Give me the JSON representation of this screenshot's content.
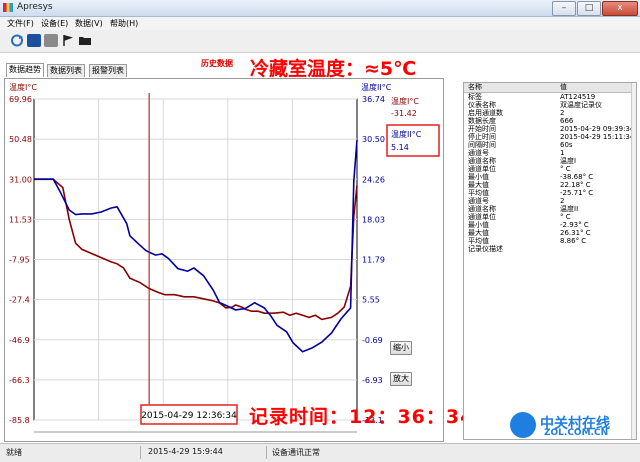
{
  "window": {
    "title": "Apresys",
    "controls": {
      "minimize": "–",
      "maximize": "□",
      "close": "x"
    }
  },
  "menu": [
    "文件(F)",
    "设备(E)",
    "数据(V)",
    "帮助(H)"
  ],
  "toolbar": {
    "icons": [
      "refresh-icon",
      "save-icon",
      "print-icon",
      "flag-icon",
      "folder-icon"
    ]
  },
  "tabs": [
    {
      "label": "数据趋势",
      "active": true
    },
    {
      "label": "数据列表",
      "active": false
    },
    {
      "label": "报警列表",
      "active": false
    }
  ],
  "history_label": "历史数据",
  "annotations": {
    "fridge_temp": "冷藏室温度：≈5℃",
    "record_time_label": "记录时间：12：36：34"
  },
  "chart_data": {
    "type": "line",
    "left_axis": {
      "title": "温度I°C",
      "ticks": [
        "69.96",
        "50.48",
        "31.00",
        "11.53",
        "-7.95",
        "-27.4",
        "-46.9",
        "-66.3",
        "-85.8"
      ],
      "range": [
        -85.8,
        69.96
      ]
    },
    "right_axis": {
      "title": "温度II°C",
      "ticks": [
        "36.74",
        "30.50",
        "24.26",
        "18.03",
        "11.79",
        "5.55",
        "-0.69",
        "-6.93",
        "-13.1"
      ],
      "range": [
        -13.1,
        36.74
      ]
    },
    "legend": [
      {
        "name": "温度I°C",
        "value": "-31.42",
        "color": "#8b0000"
      },
      {
        "name": "温度II°C",
        "value": "5.14",
        "color": "#0000a0"
      }
    ],
    "cursor_time": "2015-04-29 12:36:34",
    "series": [
      {
        "name": "温度I°C",
        "color": "#8b0000",
        "axis": "left",
        "x": [
          0,
          6,
          9,
          11,
          13,
          15,
          18,
          21,
          24,
          26,
          28,
          30,
          33,
          36,
          39,
          41,
          44,
          47,
          50,
          53,
          56,
          58,
          60,
          62,
          63,
          65,
          66,
          68,
          70,
          72,
          75,
          78,
          80,
          82,
          84,
          86,
          88,
          90,
          93,
          95,
          97,
          99,
          100,
          101
        ],
        "y": [
          31,
          31,
          27,
          11.5,
          0,
          -3,
          -5,
          -7,
          -9,
          -10,
          -12,
          -17,
          -19,
          -22,
          -24,
          -25,
          -25,
          -26,
          -26,
          -27,
          -28,
          -29,
          -31.4,
          -31,
          -30,
          -31,
          -32,
          -33,
          -33,
          -34,
          -34,
          -33.5,
          -35,
          -34,
          -35,
          -36,
          -35,
          -37,
          -36,
          -34,
          -31,
          -21,
          13,
          28
        ]
      },
      {
        "name": "温度II°C",
        "color": "#0000a0",
        "axis": "right",
        "x": [
          0,
          6,
          8,
          11,
          13,
          15,
          18,
          21,
          24,
          26,
          29,
          30,
          33,
          35,
          38,
          40,
          42,
          45,
          48,
          50,
          53,
          56,
          58,
          60,
          63,
          66,
          69,
          72,
          74,
          76,
          79,
          81,
          84,
          87,
          90,
          93,
          96,
          99,
          100,
          101
        ],
        "y": [
          24.3,
          24.3,
          22.5,
          19.5,
          18.8,
          18.9,
          18.9,
          19.2,
          19.8,
          20,
          17.4,
          15.5,
          14.1,
          13.2,
          12.5,
          12.7,
          12,
          10.4,
          10,
          10.5,
          9.3,
          7.1,
          5.14,
          4.7,
          4,
          4.2,
          5.1,
          4.3,
          3.1,
          1.6,
          0.6,
          -1.1,
          -2.5,
          -1.9,
          -1,
          0.4,
          2.6,
          4.3,
          24,
          30.4
        ]
      }
    ],
    "grid": true
  },
  "zoom_buttons": {
    "zoom_out": "缩小",
    "zoom_in": "放大"
  },
  "properties": {
    "header": {
      "name": "名称",
      "value": "值"
    },
    "rows": [
      {
        "name": "标签",
        "value": "AT124519"
      },
      {
        "name": "仪表名称",
        "value": "双温度记录仪"
      },
      {
        "name": "启用通道数",
        "value": "2"
      },
      {
        "name": "数据长度",
        "value": "666"
      },
      {
        "name": "开始时间",
        "value": "2015-04-29 09:39:34"
      },
      {
        "name": "停止时间",
        "value": "2015-04-29 15:11:34"
      },
      {
        "name": "间隔时间",
        "value": "60s"
      },
      {
        "name": "通道号",
        "value": "1"
      },
      {
        "name": "通道名称",
        "value": "温度I"
      },
      {
        "name": "通道单位",
        "value": "° C"
      },
      {
        "name": "最小值",
        "value": "-38.68° C"
      },
      {
        "name": "最大值",
        "value": "22.18° C"
      },
      {
        "name": "平均值",
        "value": "-25.71° C"
      },
      {
        "name": "通道号",
        "value": "2"
      },
      {
        "name": "通道名称",
        "value": "温度II"
      },
      {
        "name": "通道单位",
        "value": "° C"
      },
      {
        "name": "最小值",
        "value": "-2.93° C"
      },
      {
        "name": "最大值",
        "value": "26.31° C"
      },
      {
        "name": "平均值",
        "value": "8.86° C"
      },
      {
        "name": "记录仪描述",
        "value": ""
      }
    ]
  },
  "status": {
    "state": "就绪",
    "datetime": "2015-4-29 15:9:44",
    "comm": "设备通讯正常"
  },
  "watermark": {
    "cn": "中关村在线",
    "en": "ZOL.COM.CN"
  },
  "colors": {
    "series1": "#8b0000",
    "series2": "#0000a0",
    "cursor": "#b00000",
    "annotation": "#ff0000"
  }
}
